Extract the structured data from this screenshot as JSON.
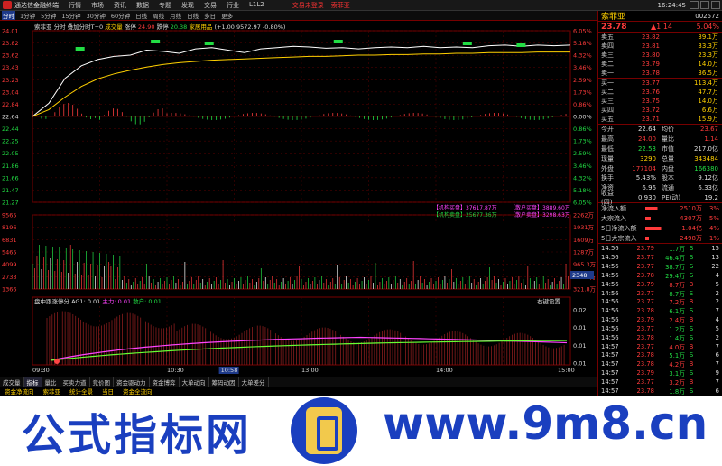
{
  "window": {
    "app_name": "通达信金融终端",
    "menu": [
      "行情",
      "市场",
      "资讯",
      "数据",
      "专题",
      "发现",
      "交易",
      "行业",
      "L1L2"
    ],
    "notice": "交易未登录",
    "stock_tab": "索菲亚",
    "clock": "16:24:45"
  },
  "period_tabs": [
    "分时",
    "1分钟",
    "5分钟",
    "15分钟",
    "30分钟",
    "60分钟",
    "日线",
    "周线",
    "月线",
    "日线",
    "多日",
    "更多"
  ],
  "chart_header": {
    "name": "索菲亚",
    "mode": "分时",
    "options": "叠加分时T+0",
    "vol_label": "成交量",
    "change_label": "涨停",
    "change_value": "24.90",
    "limit_down_label": "跌停",
    "limit_down_value": "20.38",
    "ref_label": "家居用品",
    "index_info": "(+1.00 9572.97 -0.80%)"
  },
  "price_axis": {
    "left": [
      "24.01",
      "23.82",
      "23.62",
      "23.43",
      "23.23",
      "23.04",
      "22.84",
      "22.64",
      "22.44",
      "22.25",
      "22.05",
      "21.86",
      "21.66",
      "21.47",
      "21.27"
    ],
    "right": [
      "6.05%",
      "5.18%",
      "4.32%",
      "3.46%",
      "2.59%",
      "1.73%",
      "0.86%",
      "0.00%",
      "0.86%",
      "1.73%",
      "2.59%",
      "3.46%",
      "4.32%",
      "5.18%",
      "6.05%"
    ]
  },
  "volume_axis": {
    "left": [
      "9565",
      "8196",
      "6831",
      "5465",
      "4099",
      "2733",
      "1366"
    ],
    "right": [
      "2262万",
      "1931万",
      "1609万",
      "1287万",
      "965.3万",
      "643.6万",
      "321.8万"
    ]
  },
  "volume_badge": "2348",
  "legend": {
    "line1_a": "【机构买盘】37617.87万",
    "line1_b": "【散户买盘】3889.60万",
    "line2_a": "【机构卖盘】25677.36万",
    "line2_b": "【散户卖盘】3298.63万"
  },
  "indicator": {
    "title": "盘中跟涨停分",
    "ag_label": "AG1:",
    "ag_value": "0.01",
    "main_label": "主力:",
    "main_value": "0.01",
    "retail_label": "散户:",
    "retail_value": "0.01",
    "corner": "右键设置",
    "axis": [
      "0.02",
      "0.01",
      "0.01",
      "0.01"
    ]
  },
  "time_axis": [
    "09:30",
    "10:30",
    "10:58",
    "13:00",
    "14:00",
    "15:00"
  ],
  "bottom_tabs": [
    "成交量",
    "指标",
    "量比",
    "买卖力道",
    "竞价图",
    "资金驱动力",
    "资金博弈",
    "大单动向",
    "筹码动因",
    "大单差分"
  ],
  "bottom_tabs2": [
    "资金净流向",
    "索菲亚",
    "统计全景",
    "当日",
    "资金全流向"
  ],
  "right_panel": {
    "name": "索菲亚",
    "code": "002572",
    "price": "23.78",
    "change": "▲1.14",
    "pct": "5.04%",
    "sells": [
      {
        "label": "卖五",
        "price": "23.82",
        "vol": "39.1万"
      },
      {
        "label": "卖四",
        "price": "23.81",
        "vol": "33.3万"
      },
      {
        "label": "卖三",
        "price": "23.80",
        "vol": "23.3万"
      },
      {
        "label": "卖二",
        "price": "23.79",
        "vol": "14.0万"
      },
      {
        "label": "卖一",
        "price": "23.78",
        "vol": "36.5万"
      }
    ],
    "buys": [
      {
        "label": "买一",
        "price": "23.77",
        "vol": "113.4万"
      },
      {
        "label": "买二",
        "price": "23.76",
        "vol": "47.7万"
      },
      {
        "label": "买三",
        "price": "23.75",
        "vol": "14.0万"
      },
      {
        "label": "买四",
        "price": "23.72",
        "vol": "6.6万"
      },
      {
        "label": "买五",
        "price": "23.71",
        "vol": "15.9万"
      }
    ],
    "info": [
      {
        "k": "今开",
        "v": "22.64",
        "vc": "wht",
        "k2": "均价",
        "v2": "23.67",
        "v2c": "red"
      },
      {
        "k": "最高",
        "v": "24.00",
        "vc": "red",
        "k2": "量比",
        "v2": "1.14",
        "v2c": "red"
      },
      {
        "k": "最低",
        "v": "22.53",
        "vc": "grn",
        "k2": "市值",
        "v2": "217.0亿",
        "v2c": "wht"
      },
      {
        "k": "现量",
        "v": "3290",
        "vc": "yel",
        "k2": "总量",
        "v2": "343484",
        "v2c": "yel"
      },
      {
        "k": "外盘",
        "v": "177104",
        "vc": "red",
        "k2": "内盘",
        "v2": "166380",
        "v2c": "grn"
      },
      {
        "k": "换手",
        "v": "5.43%",
        "vc": "wht",
        "k2": "股本",
        "v2": "9.12亿",
        "v2c": "wht"
      },
      {
        "k": "净资",
        "v": "6.96",
        "vc": "wht",
        "k2": "流通",
        "v2": "6.33亿",
        "v2c": "wht"
      },
      {
        "k": "收益(四)",
        "v": "0.930",
        "vc": "wht",
        "k2": "PE(动)",
        "v2": "19.2",
        "v2c": "wht"
      }
    ],
    "flows": [
      {
        "k": "净流入额",
        "v": "2510万",
        "p": "3%",
        "w": 14
      },
      {
        "k": "大宗流入",
        "v": "4307万",
        "p": "5%",
        "w": 6
      },
      {
        "k": "5日净流入额",
        "v": "1.04亿",
        "p": "4%",
        "w": 18
      },
      {
        "k": "5日大宗流入",
        "v": "2498万",
        "p": "1%",
        "w": 4
      }
    ],
    "ticks": [
      {
        "t": "14:56",
        "p": "23.79",
        "v": "1.7万",
        "s": "S",
        "n": "15"
      },
      {
        "t": "14:56",
        "p": "23.77",
        "v": "46.4万",
        "s": "S",
        "n": "13"
      },
      {
        "t": "14:56",
        "p": "23.77",
        "v": "38.7万",
        "s": "S",
        "n": "22"
      },
      {
        "t": "14:56",
        "p": "23.78",
        "v": "29.4万",
        "s": "S",
        "n": "4"
      },
      {
        "t": "14:56",
        "p": "23.79",
        "v": "8.7万",
        "s": "B",
        "n": "5"
      },
      {
        "t": "14:56",
        "p": "23.77",
        "v": "8.7万",
        "s": "S",
        "n": "2"
      },
      {
        "t": "14:56",
        "p": "23.77",
        "v": "7.2万",
        "s": "B",
        "n": "2"
      },
      {
        "t": "14:56",
        "p": "23.78",
        "v": "6.1万",
        "s": "S",
        "n": "7"
      },
      {
        "t": "14:56",
        "p": "23.79",
        "v": "2.4万",
        "s": "B",
        "n": "4"
      },
      {
        "t": "14:56",
        "p": "23.77",
        "v": "1.2万",
        "s": "S",
        "n": "5"
      },
      {
        "t": "14:56",
        "p": "23.78",
        "v": "1.4万",
        "s": "S",
        "n": "2"
      },
      {
        "t": "14:57",
        "p": "23.77",
        "v": "4.0万",
        "s": "B",
        "n": "7"
      },
      {
        "t": "14:57",
        "p": "23.78",
        "v": "5.1万",
        "s": "S",
        "n": "6"
      },
      {
        "t": "14:57",
        "p": "23.78",
        "v": "4.2万",
        "s": "B",
        "n": "7"
      },
      {
        "t": "14:57",
        "p": "23.79",
        "v": "3.1万",
        "s": "S",
        "n": "9"
      },
      {
        "t": "14:57",
        "p": "23.77",
        "v": "3.2万",
        "s": "B",
        "n": "7"
      },
      {
        "t": "14:57",
        "p": "23.78",
        "v": "1.8万",
        "s": "S",
        "n": "6"
      },
      {
        "t": "14:57",
        "p": "23.78",
        "v": "4.2万",
        "s": "B",
        "n": "4"
      },
      {
        "t": "14:57",
        "p": "23.78",
        "v": "1.2万",
        "s": "S",
        "n": "8"
      },
      {
        "t": "14:57",
        "p": "23.79",
        "v": "18.9万",
        "s": "S",
        "n": "36"
      }
    ]
  },
  "watermark": {
    "left": "公式指标网",
    "right": "www.9m8.cn"
  },
  "chart_data": {
    "type": "line",
    "title": "",
    "x_range": [
      "09:30",
      "15:00"
    ],
    "ylim": [
      21.27,
      24.01
    ],
    "prev_close": 22.64,
    "series": [
      {
        "values": [
          22.64,
          22.85,
          23.25,
          23.45,
          23.55,
          23.6,
          23.62,
          23.7,
          23.68,
          23.65,
          23.72,
          23.74,
          23.7,
          23.66,
          23.72,
          23.74,
          23.76,
          23.75,
          23.73,
          23.74,
          23.72,
          23.74,
          23.75,
          23.74,
          23.76,
          23.74,
          23.75,
          23.74,
          23.77,
          23.78,
          23.76,
          23.78,
          23.77,
          23.78
        ]
      },
      {
        "values": [
          22.64,
          22.75,
          22.95,
          23.12,
          23.24,
          23.32,
          23.38,
          23.43,
          23.47,
          23.5,
          23.52,
          23.54,
          23.55,
          23.56,
          23.57,
          23.58,
          23.59,
          23.6,
          23.6,
          23.61,
          23.62,
          23.62,
          23.63,
          23.63,
          23.64,
          23.64,
          23.65,
          23.65,
          23.66,
          23.66,
          23.66,
          23.67,
          23.67,
          23.67
        ]
      }
    ]
  }
}
